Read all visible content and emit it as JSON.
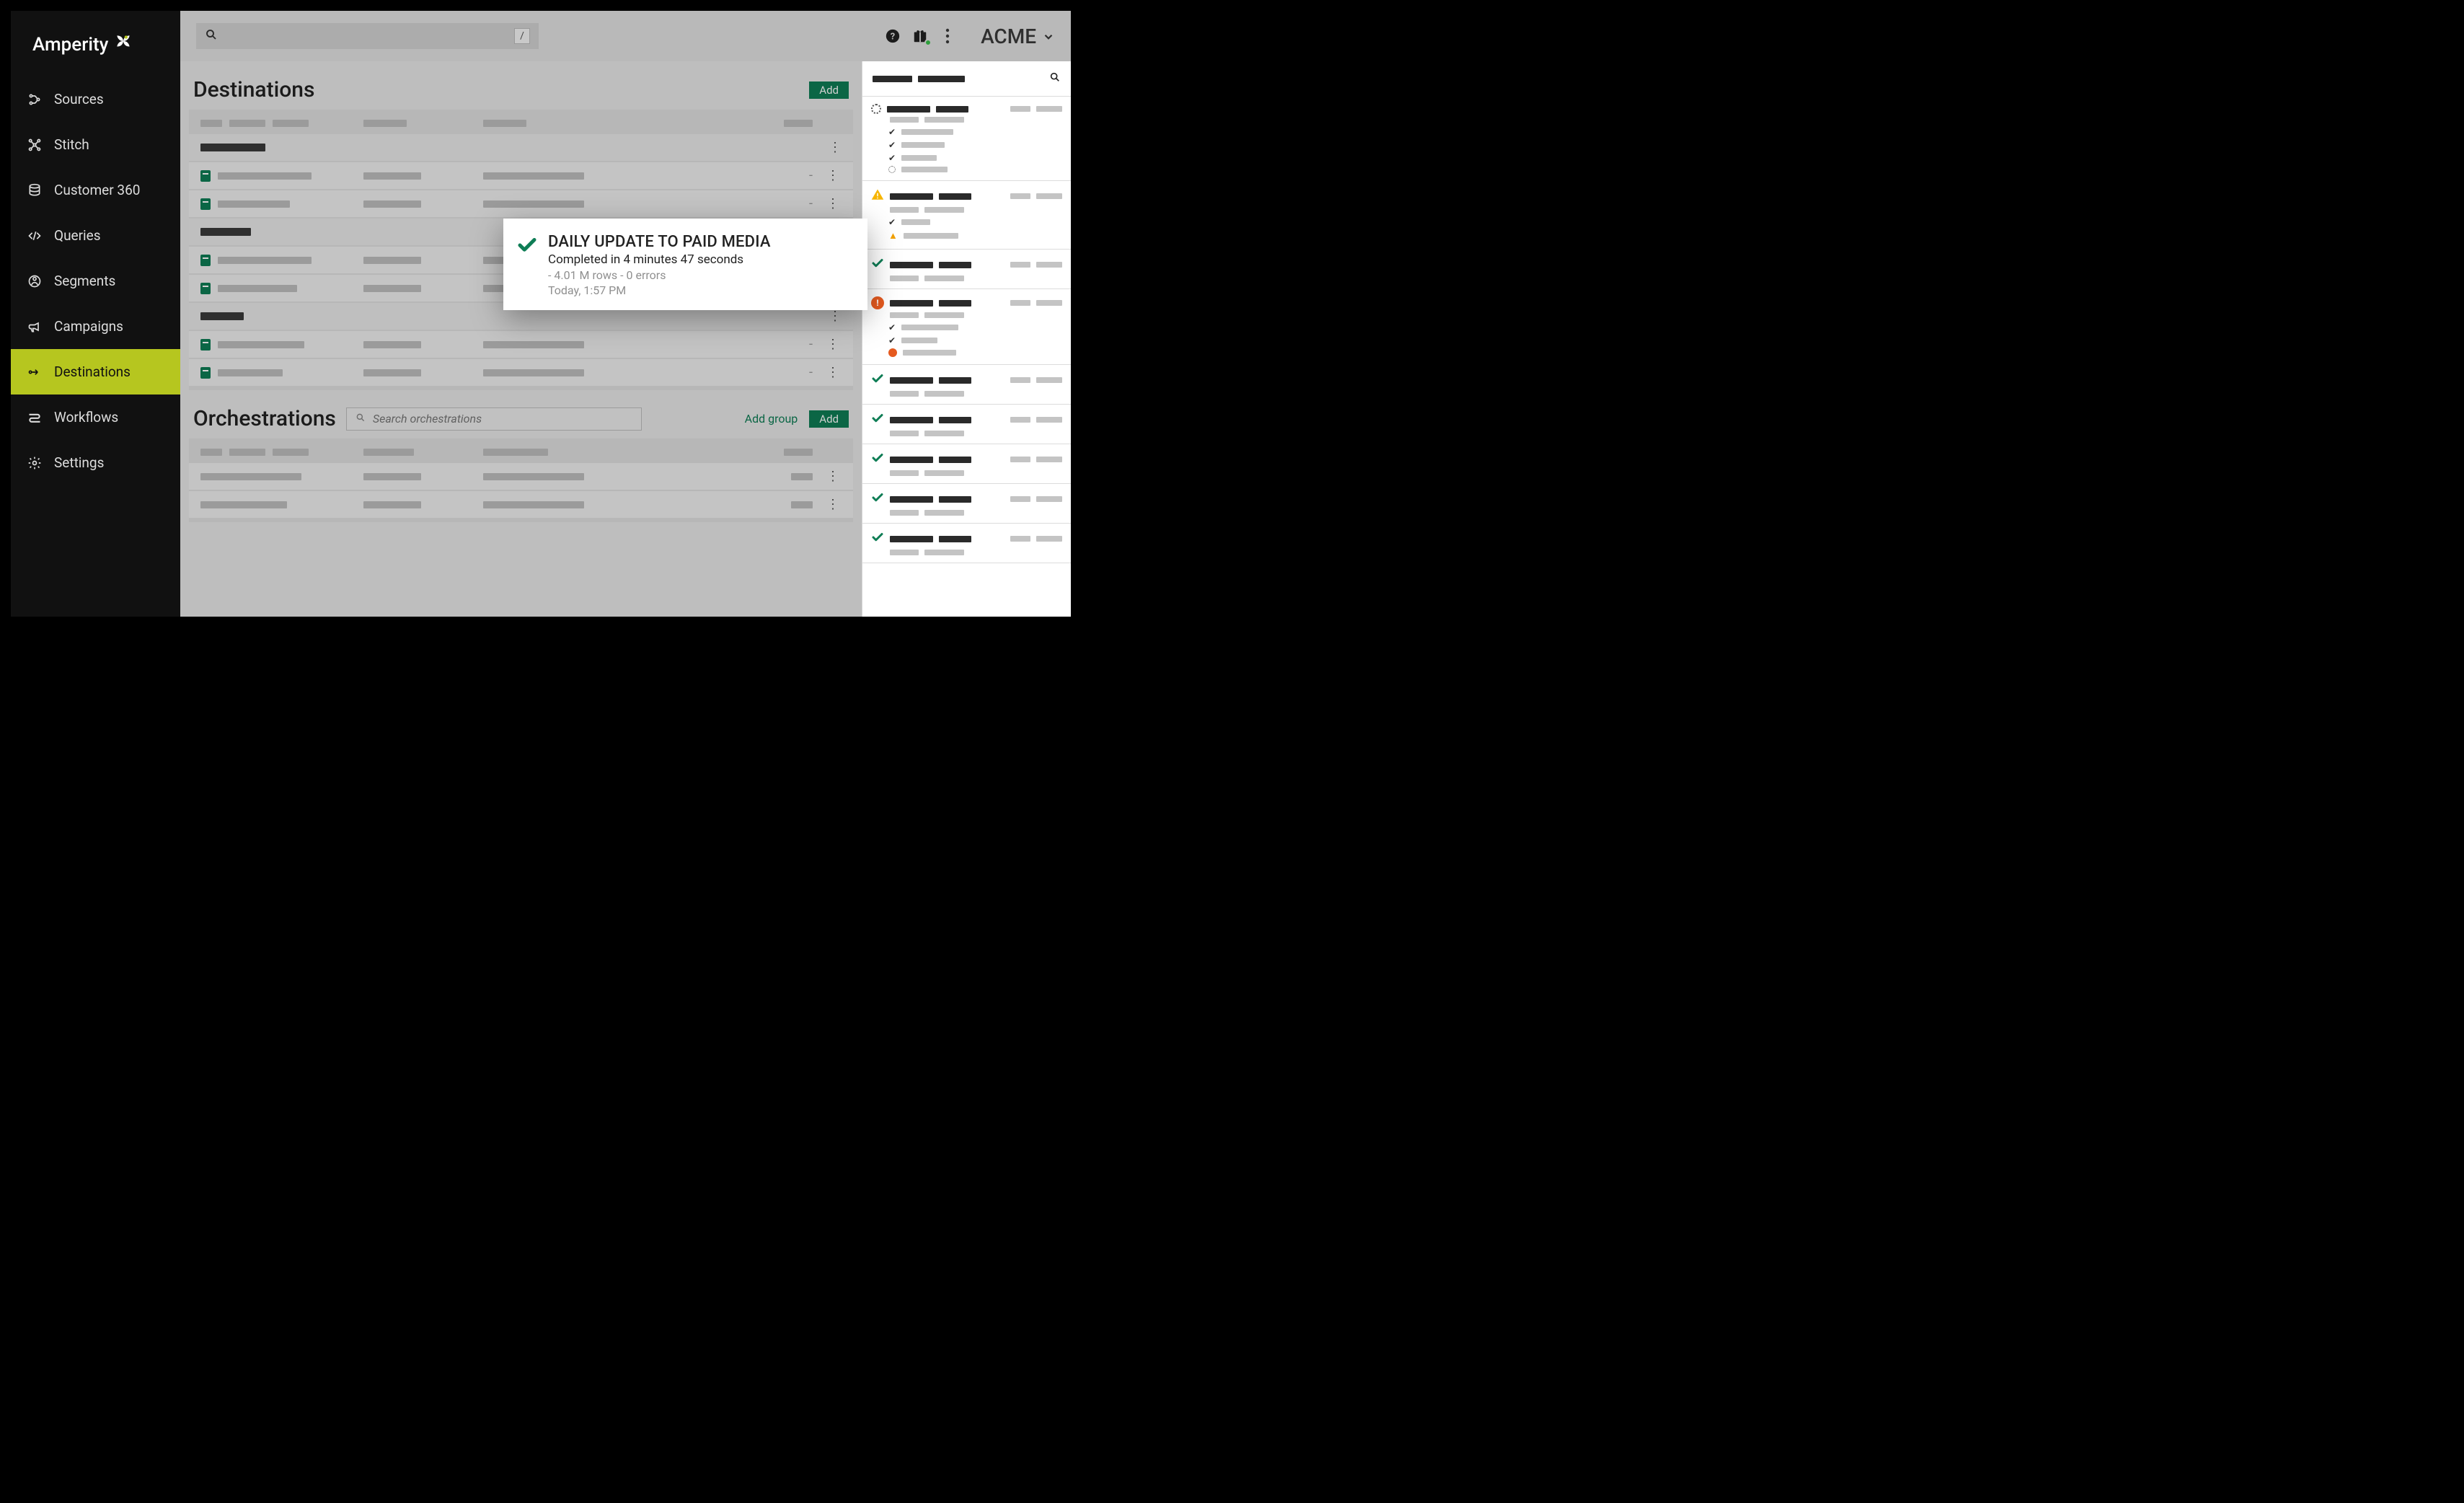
{
  "brand": {
    "name": "Amperity"
  },
  "sidebar": {
    "items": [
      {
        "label": "Sources"
      },
      {
        "label": "Stitch"
      },
      {
        "label": "Customer 360"
      },
      {
        "label": "Queries"
      },
      {
        "label": "Segments"
      },
      {
        "label": "Campaigns"
      },
      {
        "label": "Destinations"
      },
      {
        "label": "Workflows"
      },
      {
        "label": "Settings"
      }
    ],
    "active_index": 6
  },
  "header": {
    "tenant": "ACME",
    "search_placeholder": "",
    "slash_hint": "/"
  },
  "destinations": {
    "title": "Destinations",
    "add_label": "Add"
  },
  "orchestrations": {
    "title": "Orchestrations",
    "search_placeholder": "Search orchestrations",
    "add_group_label": "Add group",
    "add_label": "Add"
  },
  "callout": {
    "title": "DAILY UPDATE TO PAID MEDIA",
    "completed": "Completed in 4 minutes 47 seconds",
    "rows_errors": "- 4.01 M rows - 0 errors",
    "timestamp": "Today, 1:57 PM"
  },
  "right_rail": {
    "cards": [
      {
        "status": "loading",
        "sublist": [
          "check",
          "check",
          "check",
          "loading"
        ]
      },
      {
        "status": "warn",
        "sublist": [
          "check",
          "warn"
        ]
      },
      {
        "status": "check"
      },
      {
        "status": "error",
        "sublist": [
          "check",
          "check",
          "error"
        ]
      },
      {
        "status": "check"
      },
      {
        "status": "check"
      },
      {
        "status": "check"
      },
      {
        "status": "check"
      },
      {
        "status": "check"
      }
    ]
  }
}
